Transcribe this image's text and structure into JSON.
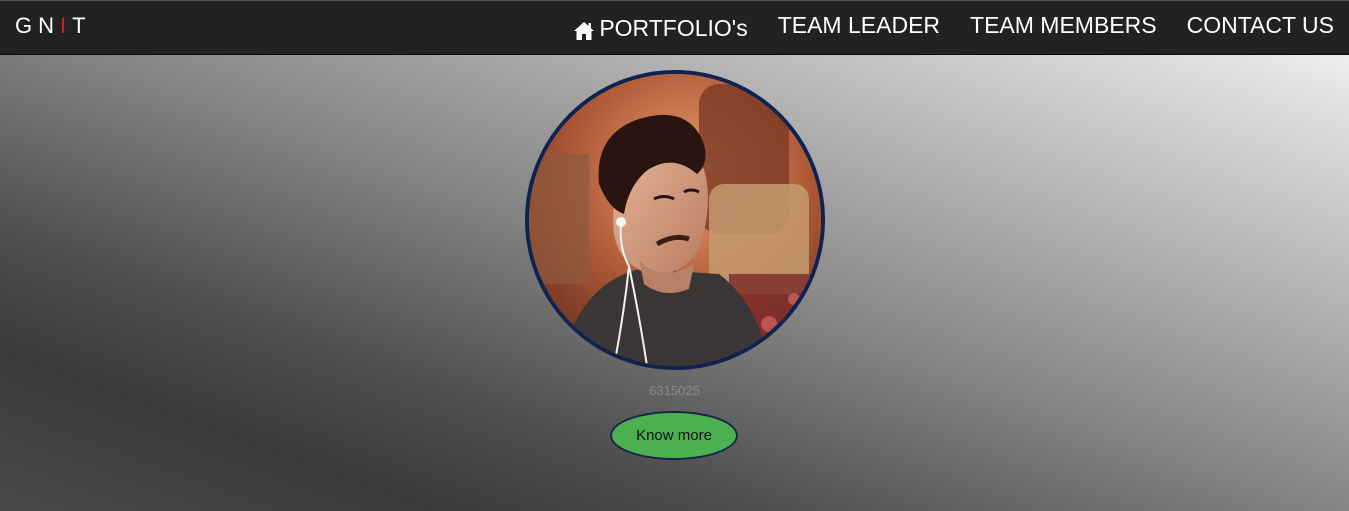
{
  "navbar": {
    "brand_letters": [
      "G",
      "N",
      "I",
      "T"
    ],
    "items": [
      {
        "label": "PORTFOLIO's",
        "icon": "house-icon"
      },
      {
        "label": "TEAM LEADER"
      },
      {
        "label": "TEAM MEMBERS"
      },
      {
        "label": "CONTACT US"
      }
    ]
  },
  "profile": {
    "caption": "6315025",
    "button_label": "Know more"
  },
  "colors": {
    "navbar_bg": "#222222",
    "brand_accent": "#cc1f1f",
    "button_bg": "#4caf50",
    "avatar_border": "#10234e"
  }
}
